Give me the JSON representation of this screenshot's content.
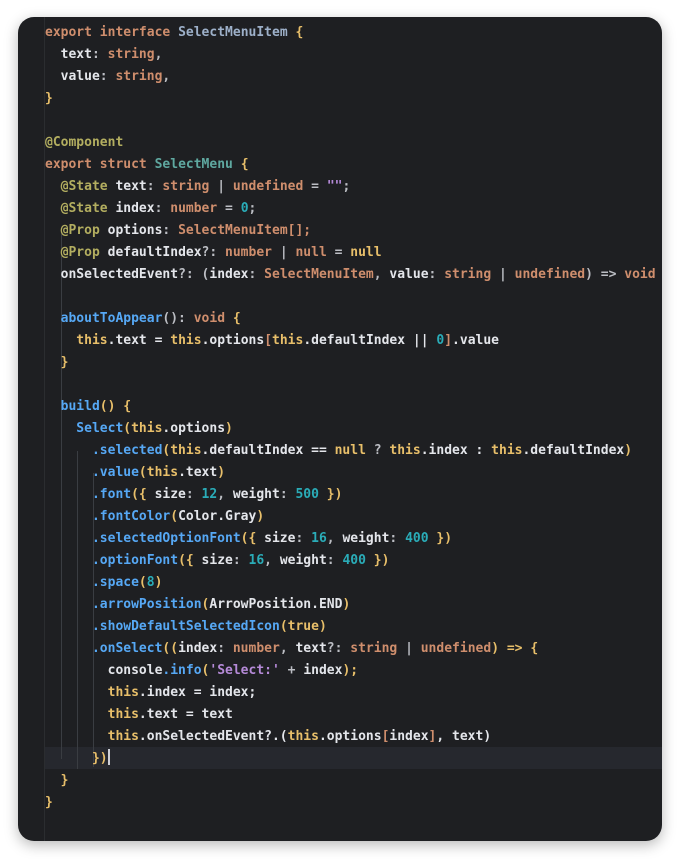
{
  "editor": {
    "lines": [
      [
        {
          "t": "export ",
          "c": "kw"
        },
        {
          "t": "interface ",
          "c": "kw"
        },
        {
          "t": "SelectMenuItem",
          "c": "id2"
        },
        {
          "t": " {",
          "c": "brk"
        }
      ],
      [
        {
          "t": "  text",
          "c": "field"
        },
        {
          "t": ": ",
          "c": "op"
        },
        {
          "t": "string",
          "c": "kw"
        },
        {
          "t": ",",
          "c": "op"
        }
      ],
      [
        {
          "t": "  value",
          "c": "field"
        },
        {
          "t": ": ",
          "c": "op"
        },
        {
          "t": "string",
          "c": "kw"
        },
        {
          "t": ",",
          "c": "op"
        }
      ],
      [
        {
          "t": "}",
          "c": "brk"
        }
      ],
      [
        {
          "t": "",
          "c": "op"
        }
      ],
      [
        {
          "t": "@Component",
          "c": "ann"
        }
      ],
      [
        {
          "t": "export ",
          "c": "kw"
        },
        {
          "t": "struct ",
          "c": "kw"
        },
        {
          "t": "SelectMenu",
          "c": "struct"
        },
        {
          "t": " {",
          "c": "brk"
        }
      ],
      [
        {
          "t": "  @State ",
          "c": "ann"
        },
        {
          "t": "text",
          "c": "field"
        },
        {
          "t": ": ",
          "c": "op"
        },
        {
          "t": "string",
          "c": "kw"
        },
        {
          "t": " | ",
          "c": "op"
        },
        {
          "t": "undefined",
          "c": "kw"
        },
        {
          "t": " = ",
          "c": "op"
        },
        {
          "t": "\"\"",
          "c": "str"
        },
        {
          "t": ";",
          "c": "op"
        }
      ],
      [
        {
          "t": "  @State ",
          "c": "ann"
        },
        {
          "t": "index",
          "c": "field"
        },
        {
          "t": ": ",
          "c": "op"
        },
        {
          "t": "number",
          "c": "kw"
        },
        {
          "t": " = ",
          "c": "op"
        },
        {
          "t": "0",
          "c": "num"
        },
        {
          "t": ";",
          "c": "op"
        }
      ],
      [
        {
          "t": "  @Prop ",
          "c": "ann"
        },
        {
          "t": "options",
          "c": "field"
        },
        {
          "t": ": ",
          "c": "op"
        },
        {
          "t": "SelectMenuItem",
          "c": "kw"
        },
        {
          "t": "[];",
          "c": "kw"
        }
      ],
      [
        {
          "t": "  @Prop ",
          "c": "ann"
        },
        {
          "t": "defaultIndex",
          "c": "field"
        },
        {
          "t": "?: ",
          "c": "op"
        },
        {
          "t": "number",
          "c": "kw"
        },
        {
          "t": " | ",
          "c": "op"
        },
        {
          "t": "null",
          "c": "kw"
        },
        {
          "t": " = ",
          "c": "op"
        },
        {
          "t": "null",
          "c": "kwb"
        }
      ],
      [
        {
          "t": "  onSelectedEvent",
          "c": "field"
        },
        {
          "t": "?: (",
          "c": "op"
        },
        {
          "t": "index",
          "c": "field"
        },
        {
          "t": ": ",
          "c": "op"
        },
        {
          "t": "SelectMenuItem",
          "c": "kw"
        },
        {
          "t": ", ",
          "c": "op"
        },
        {
          "t": "value",
          "c": "field"
        },
        {
          "t": ": ",
          "c": "op"
        },
        {
          "t": "string",
          "c": "kw"
        },
        {
          "t": " | ",
          "c": "op"
        },
        {
          "t": "undefined",
          "c": "kw"
        },
        {
          "t": ") => ",
          "c": "op"
        },
        {
          "t": "void",
          "c": "kw"
        }
      ],
      [
        {
          "t": "",
          "c": "op"
        }
      ],
      [
        {
          "t": "  aboutToAppear",
          "c": "fn"
        },
        {
          "t": "(): ",
          "c": "op"
        },
        {
          "t": "void",
          "c": "kw"
        },
        {
          "t": " {",
          "c": "brk"
        }
      ],
      [
        {
          "t": "    this",
          "c": "kwb"
        },
        {
          "t": ".text = ",
          "c": "field"
        },
        {
          "t": "this",
          "c": "kwb"
        },
        {
          "t": ".options",
          "c": "field"
        },
        {
          "t": "[",
          "c": "kw"
        },
        {
          "t": "this",
          "c": "kwb"
        },
        {
          "t": ".defaultIndex || ",
          "c": "field"
        },
        {
          "t": "0",
          "c": "num"
        },
        {
          "t": "]",
          "c": "kw"
        },
        {
          "t": ".value",
          "c": "field"
        }
      ],
      [
        {
          "t": "  }",
          "c": "brk"
        }
      ],
      [
        {
          "t": "",
          "c": "op"
        }
      ],
      [
        {
          "t": "  build",
          "c": "fn"
        },
        {
          "t": "() {",
          "c": "brk"
        }
      ],
      [
        {
          "t": "    Select",
          "c": "fn"
        },
        {
          "t": "(",
          "c": "brk"
        },
        {
          "t": "this",
          "c": "kwb"
        },
        {
          "t": ".options",
          "c": "field"
        },
        {
          "t": ")",
          "c": "brk"
        }
      ],
      [
        {
          "t": "      .selected",
          "c": "fn"
        },
        {
          "t": "(",
          "c": "brk"
        },
        {
          "t": "this",
          "c": "kwb"
        },
        {
          "t": ".defaultIndex == ",
          "c": "field"
        },
        {
          "t": "null",
          "c": "kwb"
        },
        {
          "t": " ? ",
          "c": "op"
        },
        {
          "t": "this",
          "c": "kwb"
        },
        {
          "t": ".index : ",
          "c": "field"
        },
        {
          "t": "this",
          "c": "kwb"
        },
        {
          "t": ".defaultIndex",
          "c": "field"
        },
        {
          "t": ")",
          "c": "brk"
        }
      ],
      [
        {
          "t": "      .value",
          "c": "fn"
        },
        {
          "t": "(",
          "c": "brk"
        },
        {
          "t": "this",
          "c": "kwb"
        },
        {
          "t": ".text",
          "c": "field"
        },
        {
          "t": ")",
          "c": "brk"
        }
      ],
      [
        {
          "t": "      .font",
          "c": "fn"
        },
        {
          "t": "({ ",
          "c": "brk"
        },
        {
          "t": "size",
          "c": "field"
        },
        {
          "t": ": ",
          "c": "op"
        },
        {
          "t": "12",
          "c": "num"
        },
        {
          "t": ", ",
          "c": "op"
        },
        {
          "t": "weight",
          "c": "field"
        },
        {
          "t": ": ",
          "c": "op"
        },
        {
          "t": "500",
          "c": "num"
        },
        {
          "t": " })",
          "c": "brk"
        }
      ],
      [
        {
          "t": "      .fontColor",
          "c": "fn"
        },
        {
          "t": "(",
          "c": "brk"
        },
        {
          "t": "Color.Gray",
          "c": "field"
        },
        {
          "t": ")",
          "c": "brk"
        }
      ],
      [
        {
          "t": "      .selectedOptionFont",
          "c": "fn"
        },
        {
          "t": "({ ",
          "c": "brk"
        },
        {
          "t": "size",
          "c": "field"
        },
        {
          "t": ": ",
          "c": "op"
        },
        {
          "t": "16",
          "c": "num"
        },
        {
          "t": ", ",
          "c": "op"
        },
        {
          "t": "weight",
          "c": "field"
        },
        {
          "t": ": ",
          "c": "op"
        },
        {
          "t": "400",
          "c": "num"
        },
        {
          "t": " })",
          "c": "brk"
        }
      ],
      [
        {
          "t": "      .optionFont",
          "c": "fn"
        },
        {
          "t": "({ ",
          "c": "brk"
        },
        {
          "t": "size",
          "c": "field"
        },
        {
          "t": ": ",
          "c": "op"
        },
        {
          "t": "16",
          "c": "num"
        },
        {
          "t": ", ",
          "c": "op"
        },
        {
          "t": "weight",
          "c": "field"
        },
        {
          "t": ": ",
          "c": "op"
        },
        {
          "t": "400",
          "c": "num"
        },
        {
          "t": " })",
          "c": "brk"
        }
      ],
      [
        {
          "t": "      .space",
          "c": "fn"
        },
        {
          "t": "(",
          "c": "brk"
        },
        {
          "t": "8",
          "c": "num"
        },
        {
          "t": ")",
          "c": "brk"
        }
      ],
      [
        {
          "t": "      .arrowPosition",
          "c": "fn"
        },
        {
          "t": "(",
          "c": "brk"
        },
        {
          "t": "ArrowPosition.END",
          "c": "field"
        },
        {
          "t": ")",
          "c": "brk"
        }
      ],
      [
        {
          "t": "      .showDefaultSelectedIcon",
          "c": "fn"
        },
        {
          "t": "(",
          "c": "brk"
        },
        {
          "t": "true",
          "c": "kwb"
        },
        {
          "t": ")",
          "c": "brk"
        }
      ],
      [
        {
          "t": "      .onSelect",
          "c": "fn"
        },
        {
          "t": "((",
          "c": "brk"
        },
        {
          "t": "index",
          "c": "field"
        },
        {
          "t": ": ",
          "c": "op"
        },
        {
          "t": "number",
          "c": "kw"
        },
        {
          "t": ", ",
          "c": "op"
        },
        {
          "t": "text",
          "c": "field"
        },
        {
          "t": "?: ",
          "c": "op"
        },
        {
          "t": "string",
          "c": "kw"
        },
        {
          "t": " | ",
          "c": "op"
        },
        {
          "t": "undefined",
          "c": "kw"
        },
        {
          "t": ") => {",
          "c": "brk"
        }
      ],
      [
        {
          "t": "        console",
          "c": "field"
        },
        {
          "t": ".info",
          "c": "fn"
        },
        {
          "t": "(",
          "c": "brk"
        },
        {
          "t": "'Select:'",
          "c": "str"
        },
        {
          "t": " + ",
          "c": "op"
        },
        {
          "t": "index",
          "c": "field"
        },
        {
          "t": ");",
          "c": "brk"
        }
      ],
      [
        {
          "t": "        this",
          "c": "kwb"
        },
        {
          "t": ".index = index;",
          "c": "field"
        }
      ],
      [
        {
          "t": "        this",
          "c": "kwb"
        },
        {
          "t": ".text = text",
          "c": "field"
        }
      ],
      [
        {
          "t": "        this",
          "c": "kwb"
        },
        {
          "t": ".onSelectedEvent?.(",
          "c": "field"
        },
        {
          "t": "this",
          "c": "kwb"
        },
        {
          "t": ".options",
          "c": "field"
        },
        {
          "t": "[",
          "c": "kw"
        },
        {
          "t": "index",
          "c": "field"
        },
        {
          "t": "]",
          "c": "kw"
        },
        {
          "t": ", text)",
          "c": "field"
        }
      ],
      [
        {
          "t": "      })",
          "c": "brk"
        }
      ],
      [
        {
          "t": "  }",
          "c": "brk"
        }
      ],
      [
        {
          "t": "}",
          "c": "brk"
        }
      ]
    ],
    "colors": {
      "kw": "#cf8e6d",
      "kwb": "#e8bf6a",
      "field": "#e4e6eb",
      "op": "#bcbec4",
      "brk": "#e8bf6a",
      "fn": "#56a8f5",
      "num": "#2aacb8",
      "str": "#b58ad8",
      "ann": "#b3ae60",
      "id2": "#9db0c9",
      "struct": "#5fa8a0"
    }
  }
}
